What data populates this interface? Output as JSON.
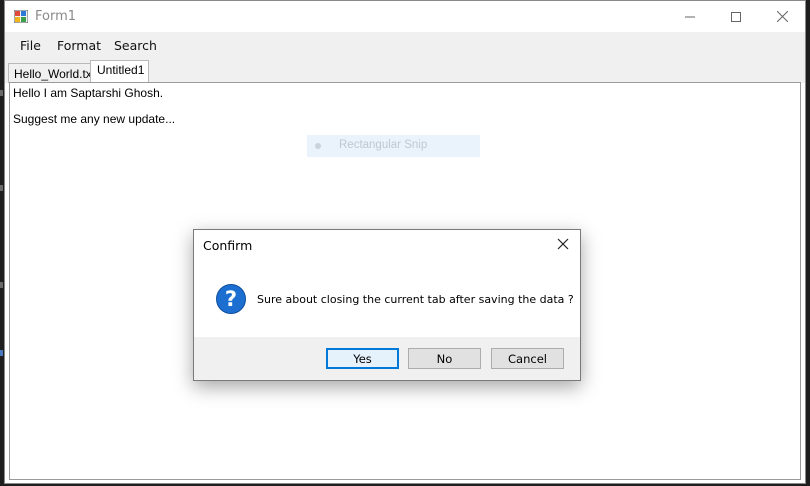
{
  "window": {
    "title": "Form1"
  },
  "menu": {
    "items": [
      "File",
      "Format",
      "Search"
    ]
  },
  "tabs": [
    {
      "label": "Hello_World.txt",
      "active": false
    },
    {
      "label": "Untitled1",
      "active": true
    }
  ],
  "editor": {
    "lines": [
      "Hello I am Saptarshi Ghosh.",
      "Suggest me any new update..."
    ]
  },
  "overlay_ghost": {
    "label": "Rectangular Snip"
  },
  "dialog": {
    "title": "Confirm",
    "icon": "question-icon",
    "message": "Sure about closing the current tab after saving the data ?",
    "buttons": {
      "yes": "Yes",
      "no": "No",
      "cancel": "Cancel"
    },
    "default_button": "Yes"
  },
  "colors": {
    "accent": "#0078d7",
    "question_icon": "#1c6fd1",
    "dialog_footer": "#f0f0f0"
  }
}
